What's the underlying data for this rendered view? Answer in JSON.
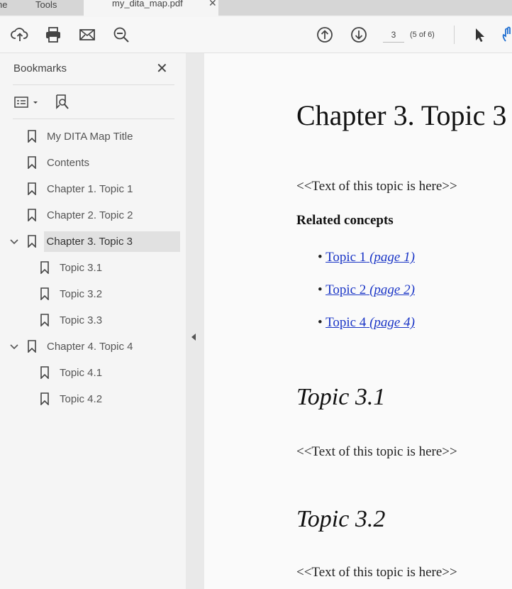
{
  "tabs": {
    "home": "ne",
    "tools": "Tools",
    "doc": "my_dita_map.pdf",
    "close": "✕"
  },
  "toolbar": {
    "page_input": "3",
    "page_count": "(5 of 6)",
    "icons": [
      "upload-icon",
      "print-icon",
      "mail-icon",
      "zoom-out-icon",
      "page-up-icon",
      "page-down-icon",
      "cursor-icon",
      "hand-icon"
    ]
  },
  "sidebar": {
    "title": "Bookmarks",
    "close": "✕",
    "items": [
      {
        "label": "My DITA Map Title"
      },
      {
        "label": "Contents"
      },
      {
        "label": "Chapter 1. Topic 1"
      },
      {
        "label": "Chapter 2. Topic 2"
      },
      {
        "label": "Chapter 3. Topic 3"
      },
      {
        "label": "Topic 3.1"
      },
      {
        "label": "Topic 3.2"
      },
      {
        "label": "Topic 3.3"
      },
      {
        "label": "Chapter 4. Topic 4"
      },
      {
        "label": "Topic 4.1"
      },
      {
        "label": "Topic 4.2"
      }
    ]
  },
  "doc": {
    "chapter_title": "Chapter 3. Topic 3",
    "text1": "<<Text of this topic is here>>",
    "related": "Related concepts",
    "links": [
      {
        "label": "Topic 1",
        "page": "(page 1)"
      },
      {
        "label": "Topic 2",
        "page": "(page 2)"
      },
      {
        "label": "Topic 4",
        "page": "(page 4)"
      }
    ],
    "topic31": "Topic 3.1",
    "text2": "<<Text of this topic is here>>",
    "topic32": "Topic 3.2",
    "text3": "<<Text of this topic is here>>"
  },
  "colors": {
    "link": "#1a35c6",
    "selection": "#e1e1e1"
  }
}
